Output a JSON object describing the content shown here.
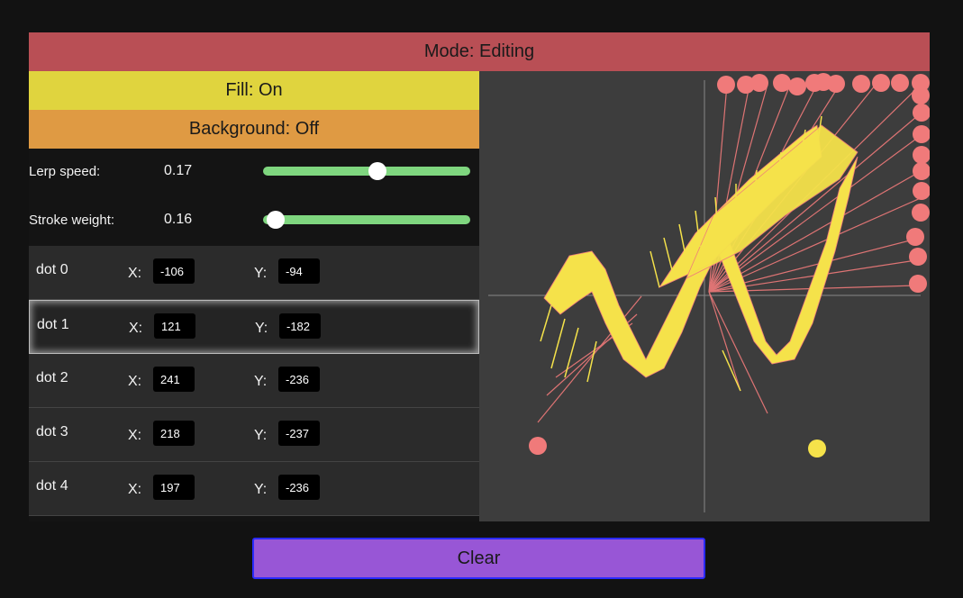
{
  "mode_label": "Mode: Editing",
  "fill_label": "Fill: On",
  "background_label": "Background: Off",
  "sliders": [
    {
      "label": "Lerp speed:",
      "value": "0.17",
      "fraction": 0.55
    },
    {
      "label": "Stroke weight:",
      "value": "0.16",
      "fraction": 0.06
    }
  ],
  "dots": [
    {
      "name": "dot 0",
      "x_label": "X:",
      "x": "-106",
      "y_label": "Y:",
      "y": "-94"
    },
    {
      "name": "dot 1",
      "x_label": "X:",
      "x": "121",
      "y_label": "Y:",
      "y": "-182"
    },
    {
      "name": "dot 2",
      "x_label": "X:",
      "x": "241",
      "y_label": "Y:",
      "y": "-236"
    },
    {
      "name": "dot 3",
      "x_label": "X:",
      "x": "218",
      "y_label": "Y:",
      "y": "-237"
    },
    {
      "name": "dot 4",
      "x_label": "X:",
      "x": "197",
      "y_label": "Y:",
      "y": "-236"
    }
  ],
  "clear_label": "Clear",
  "colors": {
    "mode_bar": "#b94f55",
    "fill_button": "#e0d43e",
    "background_button": "#df9a43",
    "slider_track": "#7fd67f",
    "clear_button": "#9856d6",
    "shape_fill": "#f5e24a",
    "shape_stroke": "#f07a7a",
    "canvas_bg": "#3d3d3d"
  }
}
